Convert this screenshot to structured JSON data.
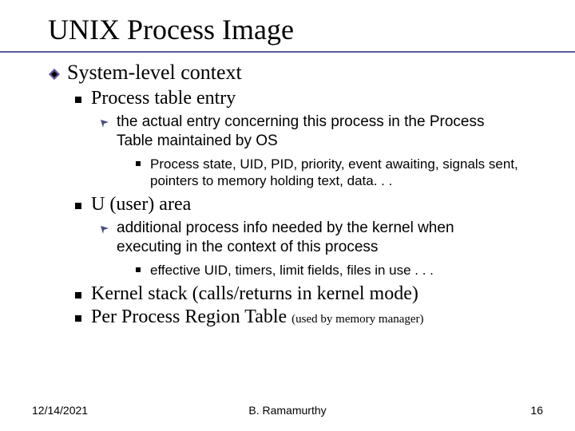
{
  "title": "UNIX Process Image",
  "l1_1": "System-level context",
  "l2_1": "Process table entry",
  "l3_1": "the actual entry concerning this process in the Process Table maintained by OS",
  "l4_1": "Process state, UID, PID, priority, event awaiting, signals sent,  pointers to memory holding text, data. . .",
  "l2_2": "U (user) area",
  "l3_2": "additional process info needed by the kernel when executing in the context of this process",
  "l4_2": "effective UID, timers, limit fields, files in use . . .",
  "l2_3": "Kernel stack (calls/returns in kernel mode)",
  "l2_4a": "Per Process Region Table ",
  "l2_4b": "(used by memory manager)",
  "footer": {
    "date": "12/14/2021",
    "author": "B. Ramamurthy",
    "page": "16"
  }
}
